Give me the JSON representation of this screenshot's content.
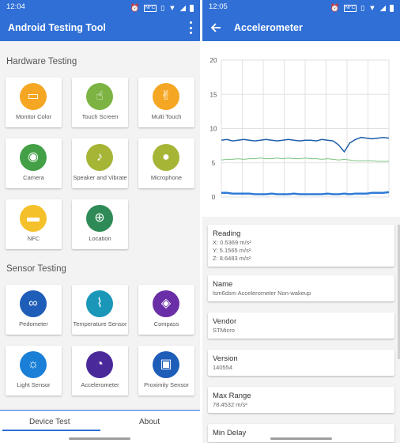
{
  "left_screen": {
    "status": {
      "time": "12:04",
      "icons": [
        "alarm-icon",
        "nfc-icon",
        "vibrate-icon",
        "wifi-icon",
        "signal-icon",
        "battery-icon"
      ]
    },
    "appbar": {
      "title": "Android Testing Tool",
      "menu_icon": "more-vert-icon"
    },
    "sections": [
      {
        "title": "Hardware Testing",
        "items": [
          {
            "label": "Monitor Color",
            "icon": "monitor-icon",
            "color": "#f5a623",
            "glyph": "▭"
          },
          {
            "label": "Touch Screen",
            "icon": "touch-icon",
            "color": "#7cb342",
            "glyph": "☝"
          },
          {
            "label": "Multi Touch",
            "icon": "multi-touch-icon",
            "color": "#f5a623",
            "glyph": "✌"
          },
          {
            "label": "Camera",
            "icon": "camera-icon",
            "color": "#43a047",
            "glyph": "◉"
          },
          {
            "label": "Speaker and Vibrate",
            "icon": "speaker-icon",
            "color": "#a6b536",
            "glyph": "♪"
          },
          {
            "label": "Microphone",
            "icon": "microphone-icon",
            "color": "#a6b536",
            "glyph": "●"
          },
          {
            "label": "NFC",
            "icon": "nfc-card-icon",
            "color": "#f5c12a",
            "glyph": "▬"
          },
          {
            "label": "Location",
            "icon": "location-icon",
            "color": "#2e8b57",
            "glyph": "⊕"
          }
        ]
      },
      {
        "title": "Sensor Testing",
        "items": [
          {
            "label": "Pedometer",
            "icon": "pedometer-icon",
            "color": "#1e5db8",
            "glyph": "∞"
          },
          {
            "label": "Temperature Sensor",
            "icon": "thermometer-icon",
            "color": "#1a97b8",
            "glyph": "⌇"
          },
          {
            "label": "Compass",
            "icon": "compass-icon",
            "color": "#6a2fa6",
            "glyph": "◈"
          },
          {
            "label": "Light Sensor",
            "icon": "light-sensor-icon",
            "color": "#1a7fd6",
            "glyph": "☼"
          },
          {
            "label": "Accelerometer",
            "icon": "speedometer-icon",
            "color": "#4a2a9a",
            "glyph": "◔"
          },
          {
            "label": "Proximity Sensor",
            "icon": "proximity-icon",
            "color": "#1e5db8",
            "glyph": "▣"
          }
        ]
      }
    ],
    "tabs": [
      "Device Test",
      "About"
    ],
    "active_tab": 0
  },
  "right_screen": {
    "status": {
      "time": "12:05",
      "icons": [
        "alarm-icon",
        "nfc-icon",
        "vibrate-icon",
        "wifi-icon",
        "signal-icon",
        "battery-icon"
      ]
    },
    "appbar": {
      "title": "Accelerometer",
      "back_icon": "arrow-back-icon"
    },
    "chart_data": {
      "type": "line",
      "ylim": [
        0,
        20
      ],
      "yticks": [
        "20",
        "15",
        "10",
        "5",
        "0"
      ],
      "grid": true,
      "series": [
        {
          "color": "#1f5fa8",
          "values": [
            8.3,
            8.4,
            8.2,
            8.3,
            8.4,
            8.3,
            8.2,
            8.3,
            8.4,
            8.3,
            8.2,
            8.3,
            8.4,
            8.3,
            8.2,
            8.3,
            8.3,
            8.2,
            8.4,
            8.3,
            8.2,
            7.6,
            6.6,
            7.9,
            8.4,
            8.7,
            8.6,
            8.5,
            8.6,
            8.7,
            8.6
          ]
        },
        {
          "color": "#7cc47f",
          "values": [
            5.4,
            5.5,
            5.5,
            5.6,
            5.5,
            5.6,
            5.6,
            5.7,
            5.6,
            5.6,
            5.7,
            5.6,
            5.7,
            5.6,
            5.6,
            5.7,
            5.6,
            5.6,
            5.5,
            5.6,
            5.5,
            5.4,
            5.5,
            5.4,
            5.3,
            5.3,
            5.3,
            5.3,
            5.2,
            5.2,
            5.2
          ]
        },
        {
          "color": "#2f7bd6",
          "values": [
            0.6,
            0.6,
            0.5,
            0.5,
            0.5,
            0.5,
            0.4,
            0.4,
            0.4,
            0.5,
            0.4,
            0.4,
            0.4,
            0.5,
            0.4,
            0.4,
            0.4,
            0.4,
            0.4,
            0.5,
            0.4,
            0.4,
            0.5,
            0.4,
            0.5,
            0.5,
            0.5,
            0.6,
            0.6,
            0.6,
            0.7
          ]
        }
      ]
    },
    "cards": [
      {
        "title": "Reading",
        "lines": [
          "X: 0.5369 m/s²",
          "Y: 5.1565 m/s²",
          "Z: 8.6483 m/s²"
        ]
      },
      {
        "title": "Name",
        "lines": [
          "lsm6dsm Accelerometer Non-wakeup"
        ]
      },
      {
        "title": "Vendor",
        "lines": [
          "STMicro"
        ]
      },
      {
        "title": "Version",
        "lines": [
          "140554"
        ]
      },
      {
        "title": "Max Range",
        "lines": [
          "78.4532 m/s²"
        ]
      },
      {
        "title": "Min Delay",
        "lines": []
      }
    ]
  }
}
